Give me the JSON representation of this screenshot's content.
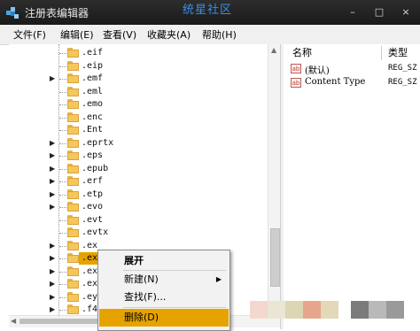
{
  "window": {
    "title": "注册表编辑器",
    "watermark": "统星社区",
    "controls": {
      "minimize": "–",
      "maximize": "□",
      "close": "×"
    }
  },
  "menubar": {
    "items": [
      "文件(F)",
      "编辑(E)",
      "查看(V)",
      "收藏夹(A)",
      "帮助(H)"
    ]
  },
  "tree": {
    "rows": [
      {
        "label": ".eif",
        "expandable": false
      },
      {
        "label": ".eip",
        "expandable": false
      },
      {
        "label": ".emf",
        "expandable": true
      },
      {
        "label": ".eml",
        "expandable": false
      },
      {
        "label": ".emo",
        "expandable": false
      },
      {
        "label": ".enc",
        "expandable": false
      },
      {
        "label": ".Ent",
        "expandable": false
      },
      {
        "label": ".eprtx",
        "expandable": true
      },
      {
        "label": ".eps",
        "expandable": true
      },
      {
        "label": ".epub",
        "expandable": true
      },
      {
        "label": ".erf",
        "expandable": true
      },
      {
        "label": ".etp",
        "expandable": true
      },
      {
        "label": ".evo",
        "expandable": true
      },
      {
        "label": ".evt",
        "expandable": false
      },
      {
        "label": ".evtx",
        "expandable": false
      },
      {
        "label": ".ex_",
        "expandable": true
      },
      {
        "label": ".exe",
        "expandable": true,
        "selected": true
      },
      {
        "label": ".exp",
        "expandable": true
      },
      {
        "label": ".ext",
        "expandable": true
      },
      {
        "label": ".eyb",
        "expandable": true
      },
      {
        "label": ".f4v",
        "expandable": true
      }
    ]
  },
  "values": {
    "headers": {
      "name": "名称",
      "type": "类型"
    },
    "rows": [
      {
        "icon": "ab",
        "name": "(默认)",
        "type": "REG_SZ"
      },
      {
        "icon": "ab",
        "name": "Content Type",
        "type": "REG_SZ"
      }
    ]
  },
  "context_menu": {
    "items": [
      {
        "label": "展开",
        "bold": true
      },
      {
        "label": "新建(N)",
        "submenu": "▶"
      },
      {
        "label": "查找(F)..."
      },
      {
        "label": "删除(D)",
        "highlight": true
      }
    ]
  },
  "colors": {
    "selection": "#e6a300",
    "titlebar": "#1e1e1e",
    "folder": "#f5c75a",
    "watermark": "#3a8ee6"
  }
}
